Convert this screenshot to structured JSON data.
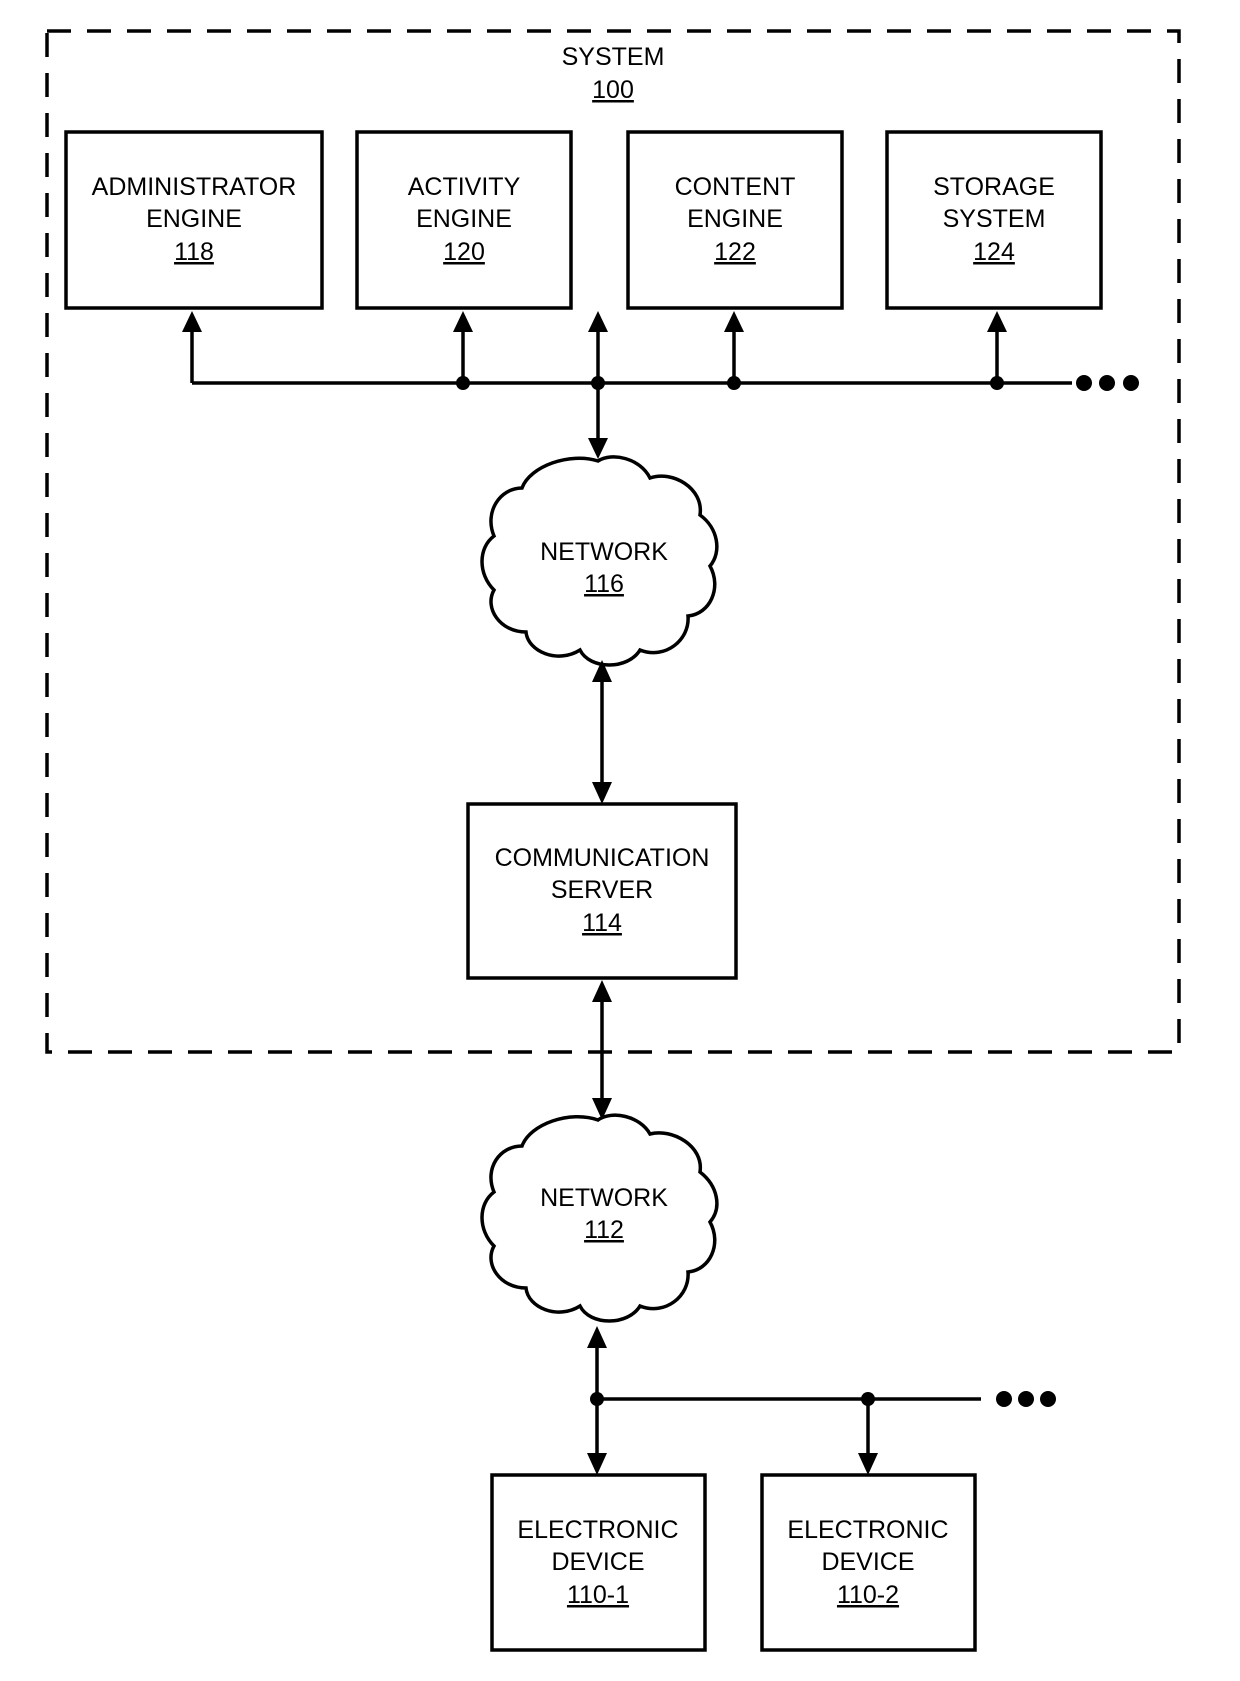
{
  "diagram": {
    "system": {
      "label": "SYSTEM",
      "ref": "100"
    },
    "components": [
      {
        "id": "admin",
        "lines": [
          "ADMINISTRATOR",
          "ENGINE"
        ],
        "ref": "118"
      },
      {
        "id": "activity",
        "lines": [
          "ACTIVITY",
          "ENGINE"
        ],
        "ref": "120"
      },
      {
        "id": "content",
        "lines": [
          "CONTENT",
          "ENGINE"
        ],
        "ref": "122"
      },
      {
        "id": "storage",
        "lines": [
          "STORAGE",
          "SYSTEM"
        ],
        "ref": "124"
      }
    ],
    "network_internal": {
      "label": "NETWORK",
      "ref": "116"
    },
    "comm_server": {
      "lines": [
        "COMMUNICATION",
        "SERVER"
      ],
      "ref": "114"
    },
    "network_external": {
      "label": "NETWORK",
      "ref": "112"
    },
    "devices": [
      {
        "id": "dev1",
        "lines": [
          "ELECTRONIC",
          "DEVICE"
        ],
        "ref": "110-1"
      },
      {
        "id": "dev2",
        "lines": [
          "ELECTRONIC",
          "DEVICE"
        ],
        "ref": "110-2"
      }
    ],
    "continuation_marker": "more-items-ellipsis"
  }
}
